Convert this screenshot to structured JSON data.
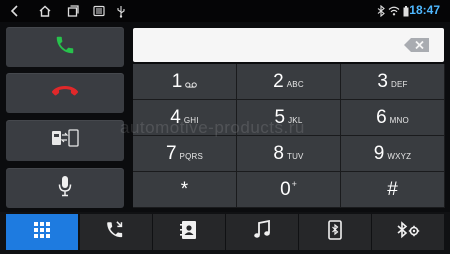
{
  "status_bar": {
    "time": "18:47",
    "icons": [
      "back-icon",
      "home-icon",
      "recent-apps-icon",
      "settings-sliders-icon",
      "usb-icon",
      "bluetooth-icon",
      "wifi-icon",
      "battery-icon"
    ]
  },
  "call_panel": {
    "answer": "phone-answer-icon",
    "hangup": "phone-hangup-icon",
    "transfer": "phone-transfer-icon",
    "mute": "microphone-icon"
  },
  "display": {
    "number": "",
    "backspace_icon": "backspace-icon"
  },
  "keypad": [
    {
      "digit": "1",
      "sub": ""
    },
    {
      "digit": "2",
      "sub": "ABC"
    },
    {
      "digit": "3",
      "sub": "DEF"
    },
    {
      "digit": "4",
      "sub": "GHI"
    },
    {
      "digit": "5",
      "sub": "JKL"
    },
    {
      "digit": "6",
      "sub": "MNO"
    },
    {
      "digit": "7",
      "sub": "PQRS"
    },
    {
      "digit": "8",
      "sub": "TUV"
    },
    {
      "digit": "9",
      "sub": "WXYZ"
    },
    {
      "digit": "*",
      "sub": ""
    },
    {
      "digit": "0",
      "sup": "+"
    },
    {
      "digit": "#",
      "sub": ""
    }
  ],
  "watermark": "automotive-products.ru",
  "bottom_nav": {
    "items": [
      {
        "name": "dialpad",
        "icon": "dialpad-icon",
        "active": true
      },
      {
        "name": "call-log",
        "icon": "call-log-icon",
        "active": false
      },
      {
        "name": "contacts",
        "icon": "contacts-icon",
        "active": false
      },
      {
        "name": "music",
        "icon": "music-icon",
        "active": false
      },
      {
        "name": "phone-sync",
        "icon": "phone-sync-icon",
        "active": false
      },
      {
        "name": "bluetooth-settings",
        "icon": "bluetooth-settings-icon",
        "active": false
      }
    ]
  },
  "colors": {
    "accent": "#1e7be0",
    "answer": "#27c24c",
    "hangup": "#e0282a",
    "time": "#4fb8ff"
  }
}
